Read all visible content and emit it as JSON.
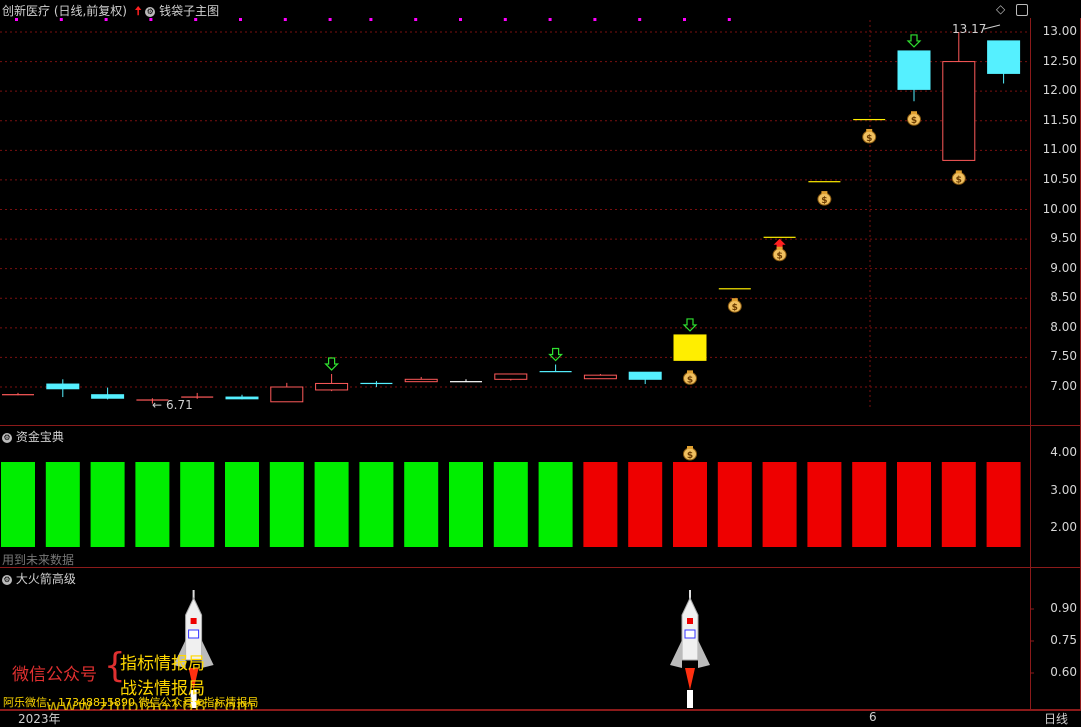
{
  "header": {
    "stock_title": "创新医疗 (日线,前复权)",
    "indicator_name": "钱袋子主图",
    "diamond_icon": "◇",
    "window_icon": "▭"
  },
  "main_chart": {
    "y_ticks": [
      "13.00",
      "12.50",
      "12.00",
      "11.50",
      "11.00",
      "10.50",
      "10.00",
      "9.50",
      "9.00",
      "8.50",
      "8.00",
      "7.50",
      "7.00"
    ],
    "high_label": "13.17",
    "low_label": "6.71",
    "candles": [
      {
        "o": 6.88,
        "c": 6.88,
        "h": 6.9,
        "l": 6.86,
        "color": "#ff5a5a"
      },
      {
        "o": 7.05,
        "c": 6.97,
        "h": 7.13,
        "l": 6.83,
        "color": "#55f0ff"
      },
      {
        "o": 6.87,
        "c": 6.81,
        "h": 6.99,
        "l": 6.79,
        "color": "#55f0ff"
      },
      {
        "o": 6.78,
        "c": 6.79,
        "h": 6.81,
        "l": 6.72,
        "color": "#ff5a5a"
      },
      {
        "o": 6.82,
        "c": 6.84,
        "h": 6.9,
        "l": 6.8,
        "color": "#ff5a5a"
      },
      {
        "o": 6.83,
        "c": 6.8,
        "h": 6.87,
        "l": 6.79,
        "color": "#55f0ff"
      },
      {
        "o": 6.75,
        "c": 7.0,
        "h": 7.07,
        "l": 6.75,
        "color": "#ff5a5a"
      },
      {
        "o": 6.95,
        "c": 7.06,
        "h": 7.22,
        "l": 6.93,
        "color": "#ff5a5a"
      },
      {
        "o": 7.07,
        "c": 7.07,
        "h": 7.1,
        "l": 7.0,
        "color": "#55f0ff"
      },
      {
        "o": 7.09,
        "c": 7.13,
        "h": 7.17,
        "l": 7.09,
        "color": "#ff5a5a"
      },
      {
        "o": 7.1,
        "c": 7.1,
        "h": 7.13,
        "l": 7.09,
        "color": "#ffffff"
      },
      {
        "o": 7.13,
        "c": 7.22,
        "h": 7.22,
        "l": 7.11,
        "color": "#ff5a5a"
      },
      {
        "o": 7.27,
        "c": 7.27,
        "h": 7.38,
        "l": 7.27,
        "color": "#55f0ff"
      },
      {
        "o": 7.14,
        "c": 7.2,
        "h": 7.22,
        "l": 7.14,
        "color": "#ff5a5a"
      },
      {
        "o": 7.25,
        "c": 7.13,
        "h": 7.25,
        "l": 7.05,
        "color": "#55f0ff"
      },
      {
        "o": 7.45,
        "c": 7.88,
        "h": 7.88,
        "l": 7.45,
        "color": "#ffee00"
      },
      {
        "o": 8.67,
        "c": 8.67,
        "h": 8.67,
        "l": 8.67,
        "color": "#ffee00"
      },
      {
        "o": 9.54,
        "c": 9.54,
        "h": 9.54,
        "l": 9.54,
        "color": "#ffee00"
      },
      {
        "o": 10.48,
        "c": 10.48,
        "h": 10.48,
        "l": 10.48,
        "color": "#ffee00"
      },
      {
        "o": 11.53,
        "c": 11.53,
        "h": 11.53,
        "l": 11.53,
        "color": "#ffee00"
      },
      {
        "o": 12.68,
        "c": 12.03,
        "h": 12.68,
        "l": 11.83,
        "color": "#55f0ff"
      },
      {
        "o": 10.83,
        "c": 12.5,
        "h": 13.0,
        "l": 10.83,
        "color": "#ff5a5a"
      },
      {
        "o": 12.85,
        "c": 12.3,
        "h": 12.85,
        "l": 12.13,
        "color": "#55f0ff"
      }
    ],
    "green_arrow_idx": [
      7,
      12,
      15,
      20
    ],
    "red_arrow_idx": [
      17
    ],
    "money_bag_idx": [
      15,
      16,
      17,
      18,
      19,
      20,
      21
    ],
    "magenta_dots": 17
  },
  "panel2": {
    "title": "资金宝典",
    "note": "用到未来数据",
    "y_ticks": [
      "4.00",
      "3.00",
      "2.00"
    ],
    "bars": [
      "g",
      "g",
      "g",
      "g",
      "g",
      "g",
      "g",
      "g",
      "g",
      "g",
      "g",
      "g",
      "g",
      "r",
      "r",
      "r",
      "r",
      "r",
      "r",
      "r",
      "r",
      "r",
      "r"
    ],
    "bar_value": 3.8,
    "bar_colors": {
      "g": "#00ee00",
      "r": "#ee0000"
    }
  },
  "panel3": {
    "title": "大火箭高级",
    "y_ticks": [
      "0.90",
      "0.75",
      "0.60"
    ],
    "rocket_idx": [
      4,
      15
    ]
  },
  "watermark": {
    "wechat": "微信公众号",
    "line1": "指标情报局",
    "line2": "战法情报局",
    "contact": "阿乐微信：17348815890    微信公众号★指标情报局",
    "url": "www.zhibiao168.com"
  },
  "footer": {
    "year": "2023年",
    "mark": "6",
    "period": "日线"
  }
}
